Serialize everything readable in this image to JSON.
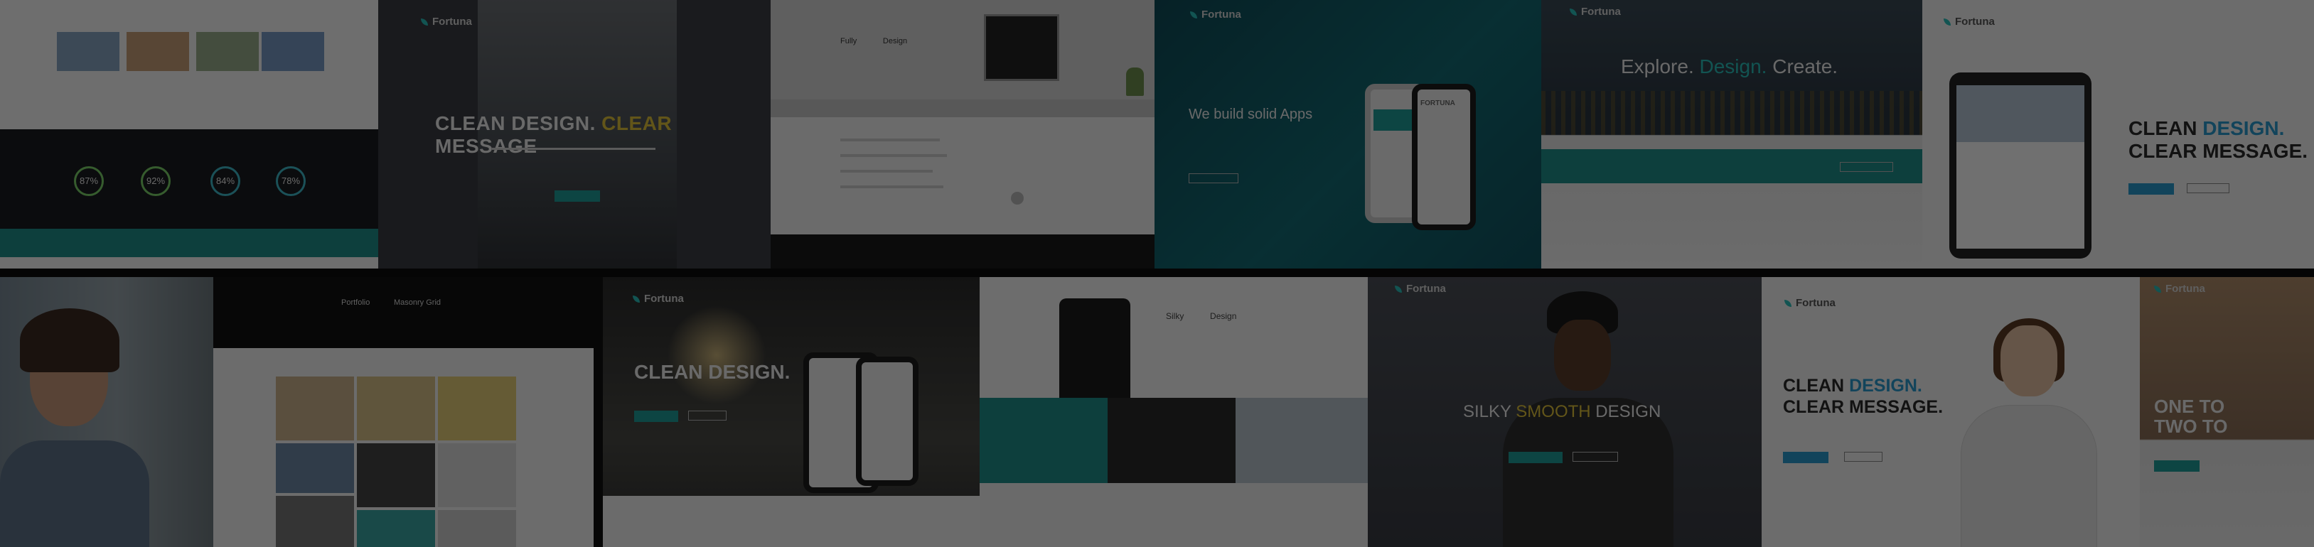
{
  "brand": {
    "name": "Fortuna"
  },
  "colors": {
    "teal": "#1e9e9a",
    "sky": "#2a9cd0",
    "yellow": "#e0c23a",
    "overlay": "rgba(0,0,0,0.56)"
  },
  "tiles": {
    "t2": {
      "headline_a": "CLEAN DESIGN.",
      "headline_b": "CLEAR",
      "headline_c": "MESSAGE"
    },
    "t3": {
      "headline_a": "Fully",
      "headline_b": "Design"
    },
    "t4": {
      "headline": "We build solid Apps",
      "phone_brand": "FORTUNA"
    },
    "t5": {
      "headline_a": "Explore.",
      "headline_b": "Design.",
      "headline_c": "Create."
    },
    "t6": {
      "line1_a": "CLEAN",
      "line1_b": "DESIGN.",
      "line2_a": "CLEAR",
      "line2_b": "MESSAGE."
    },
    "t8": {
      "title_a": "Portfolio",
      "title_b": "Masonry Grid"
    },
    "t9": {
      "headline": "CLEAN DESIGN."
    },
    "t10": {
      "title_a": "Silky",
      "title_b": "Design"
    },
    "t11": {
      "headline_a": "SILKY",
      "headline_b": "SMOOTH",
      "headline_c": "DESIGN"
    },
    "t12": {
      "line1_a": "CLEAN",
      "line1_b": "DESIGN.",
      "line2": "CLEAR MESSAGE."
    },
    "t13": {
      "line1": "ONE TO",
      "line2": "TWO TO"
    }
  },
  "stats": {
    "rings": [
      "87%",
      "92%",
      "84%",
      "78%"
    ]
  }
}
